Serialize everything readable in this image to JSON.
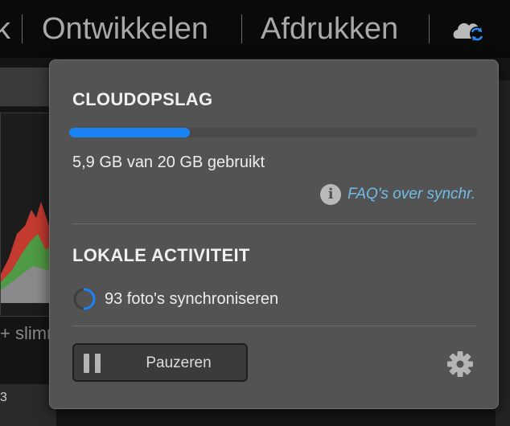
{
  "topbar": {
    "partial_module": "k",
    "modules": [
      "Ontwikkelen",
      "Afdrukken"
    ],
    "cloud_icon": "cloud-sync-icon"
  },
  "background": {
    "partial_text": "+ slimr",
    "partial_number": "3"
  },
  "popover": {
    "cloud_storage_title": "CLOUDOPSLAG",
    "storage_used_fraction": 0.295,
    "storage_usage_text": "5,9 GB van 20 GB gebruikt",
    "faq_link": "FAQ's over synchr.",
    "local_activity_title": "LOKALE ACTIVITEIT",
    "sync_status": "93 foto's synchroniseren",
    "pause_button": "Pauzeren",
    "settings_icon": "gear-icon"
  },
  "colors": {
    "accent": "#1a84f6",
    "link": "#6fbde8",
    "popover_bg": "#535353"
  }
}
